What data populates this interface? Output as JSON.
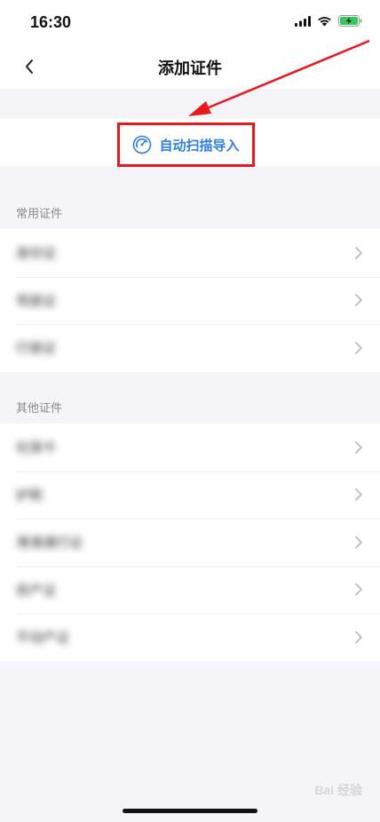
{
  "status_bar": {
    "time": "16:30",
    "icons": [
      "signal-icon",
      "wifi-icon",
      "battery-charging-icon"
    ]
  },
  "nav": {
    "title": "添加证件",
    "back_icon": "chevron-left-icon"
  },
  "scan": {
    "label": "自动扫描导入",
    "icon": "scan-gauge-icon",
    "accent_color": "#2f7de0",
    "highlight_color": "#e8191c"
  },
  "sections": [
    {
      "header": "常用证件",
      "items": [
        {
          "label": "身份证"
        },
        {
          "label": "驾驶证"
        },
        {
          "label": "行驶证"
        }
      ]
    },
    {
      "header": "其他证件",
      "items": [
        {
          "label": "社保卡"
        },
        {
          "label": "护照"
        },
        {
          "label": "港澳通行证"
        },
        {
          "label": "房产证"
        },
        {
          "label": "不动产证"
        }
      ]
    }
  ],
  "watermark": "Bai 经验"
}
